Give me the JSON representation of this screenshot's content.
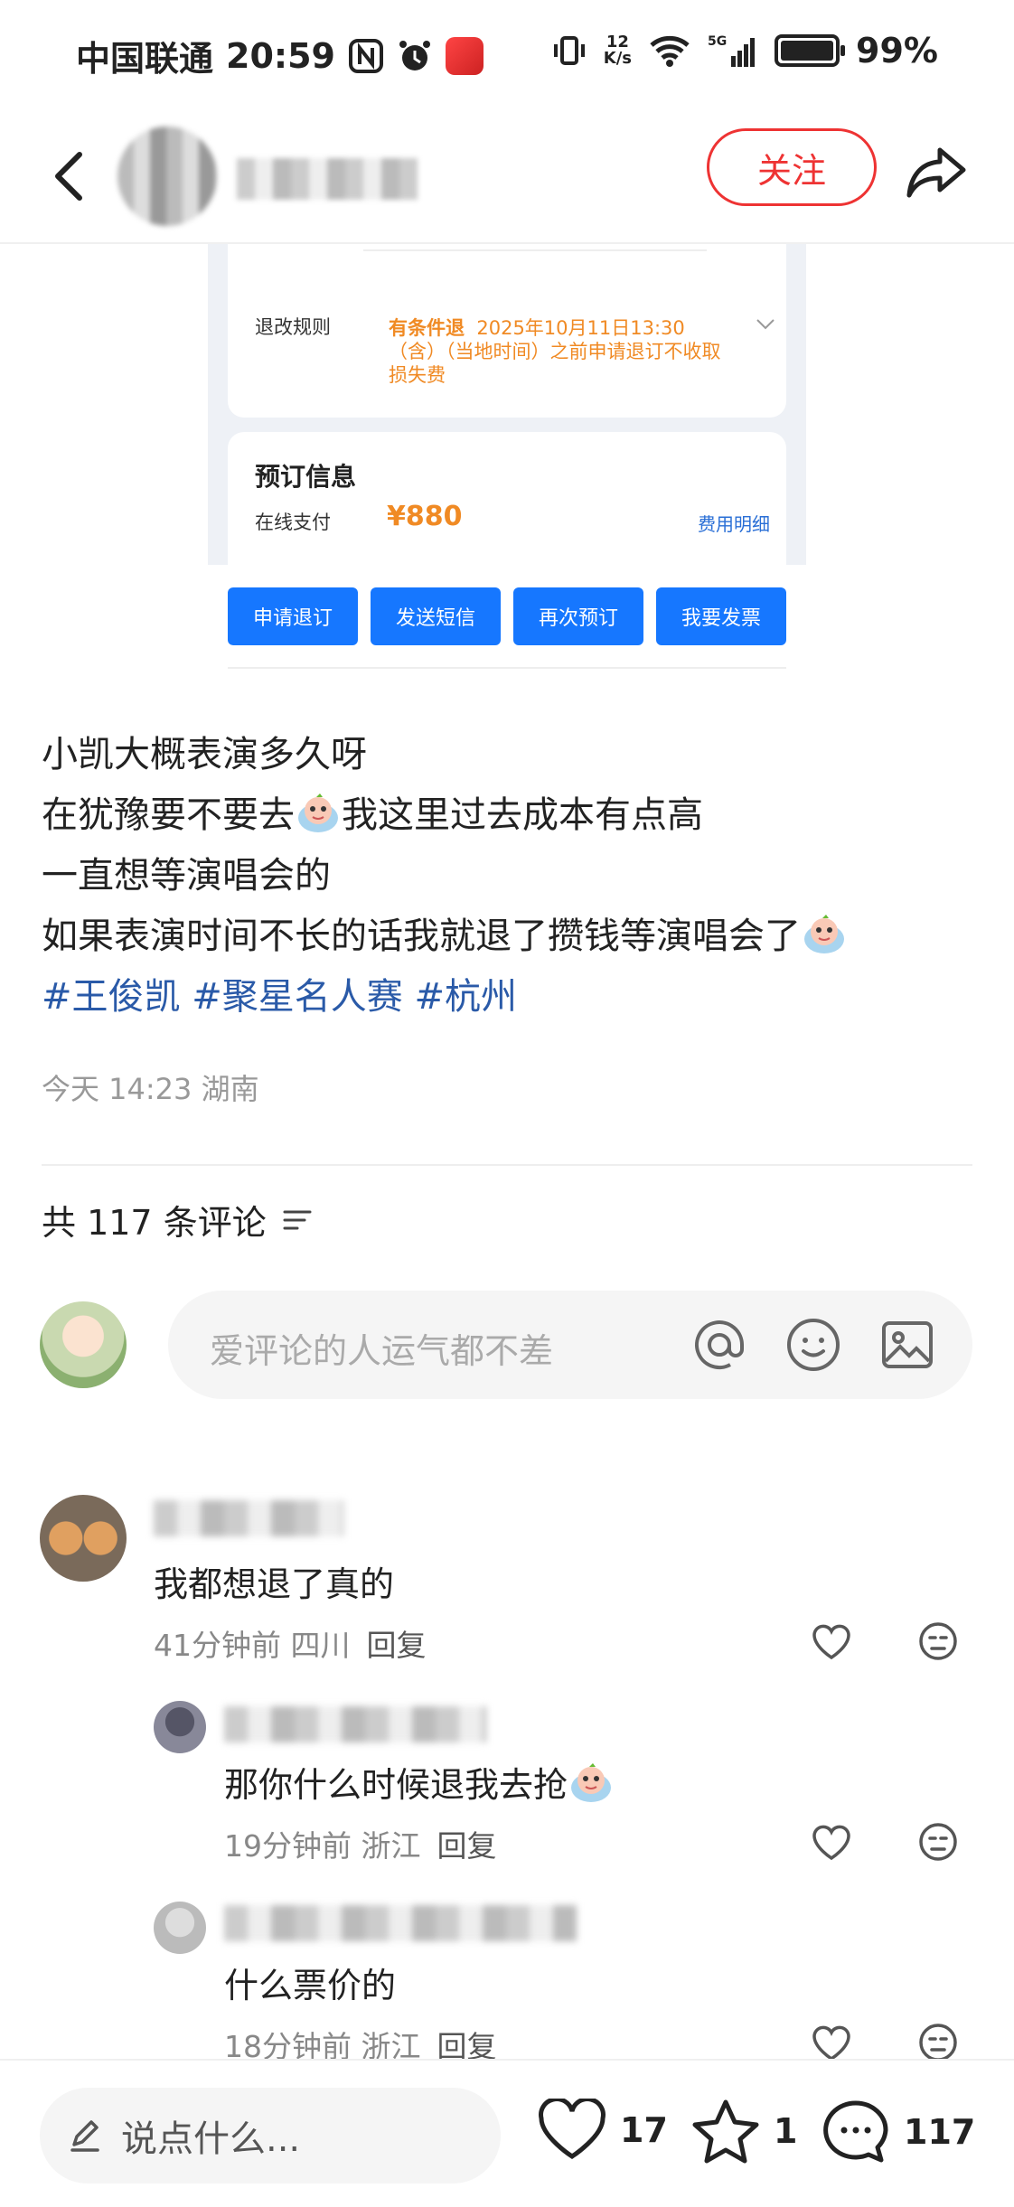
{
  "status_bar": {
    "carrier": "中国联通",
    "time": "20:59",
    "net_speed_value": "12",
    "net_speed_unit": "K/s",
    "network": "5G",
    "battery": "99%"
  },
  "header": {
    "follow_label": "关注"
  },
  "embedded_screenshot": {
    "refund_rule_label": "退改规则",
    "refund_rule_tag": "有条件退",
    "refund_rule_text": "2025年10月11日13:30（含）（当地时间）之前申请退订不收取损失费",
    "booking_title": "预订信息",
    "payment_label": "在线支付",
    "payment_amount": "¥880",
    "fee_detail_link": "费用明细",
    "buttons": [
      "申请退订",
      "发送短信",
      "再次预订",
      "我要发票"
    ]
  },
  "post": {
    "line1": "小凯大概表演多久呀",
    "line2a": "在犹豫要不要去",
    "line2b": "我这里过去成本有点高",
    "line3": "一直想等演唱会的",
    "line4": "如果表演时间不长的话我就退了攒钱等演唱会了",
    "hashtags": "#王俊凯 #聚星名人赛 #杭州",
    "meta": "今天 14:23 湖南"
  },
  "comments_header": {
    "count_text": "共 117 条评论"
  },
  "comment_input": {
    "placeholder": "爱评论的人运气都不差"
  },
  "comments": [
    {
      "text": "我都想退了真的",
      "time": "41分钟前",
      "location": "四川",
      "reply_label": "回复"
    },
    {
      "text": "那你什么时候退我去抢",
      "time": "19分钟前",
      "location": "浙江",
      "reply_label": "回复"
    },
    {
      "text": "什么票价的",
      "time": "18分钟前",
      "location": "浙江",
      "reply_label": "回复"
    }
  ],
  "bottom_bar": {
    "say_placeholder": "说点什么...",
    "likes": "17",
    "stars": "1",
    "comments": "117"
  }
}
